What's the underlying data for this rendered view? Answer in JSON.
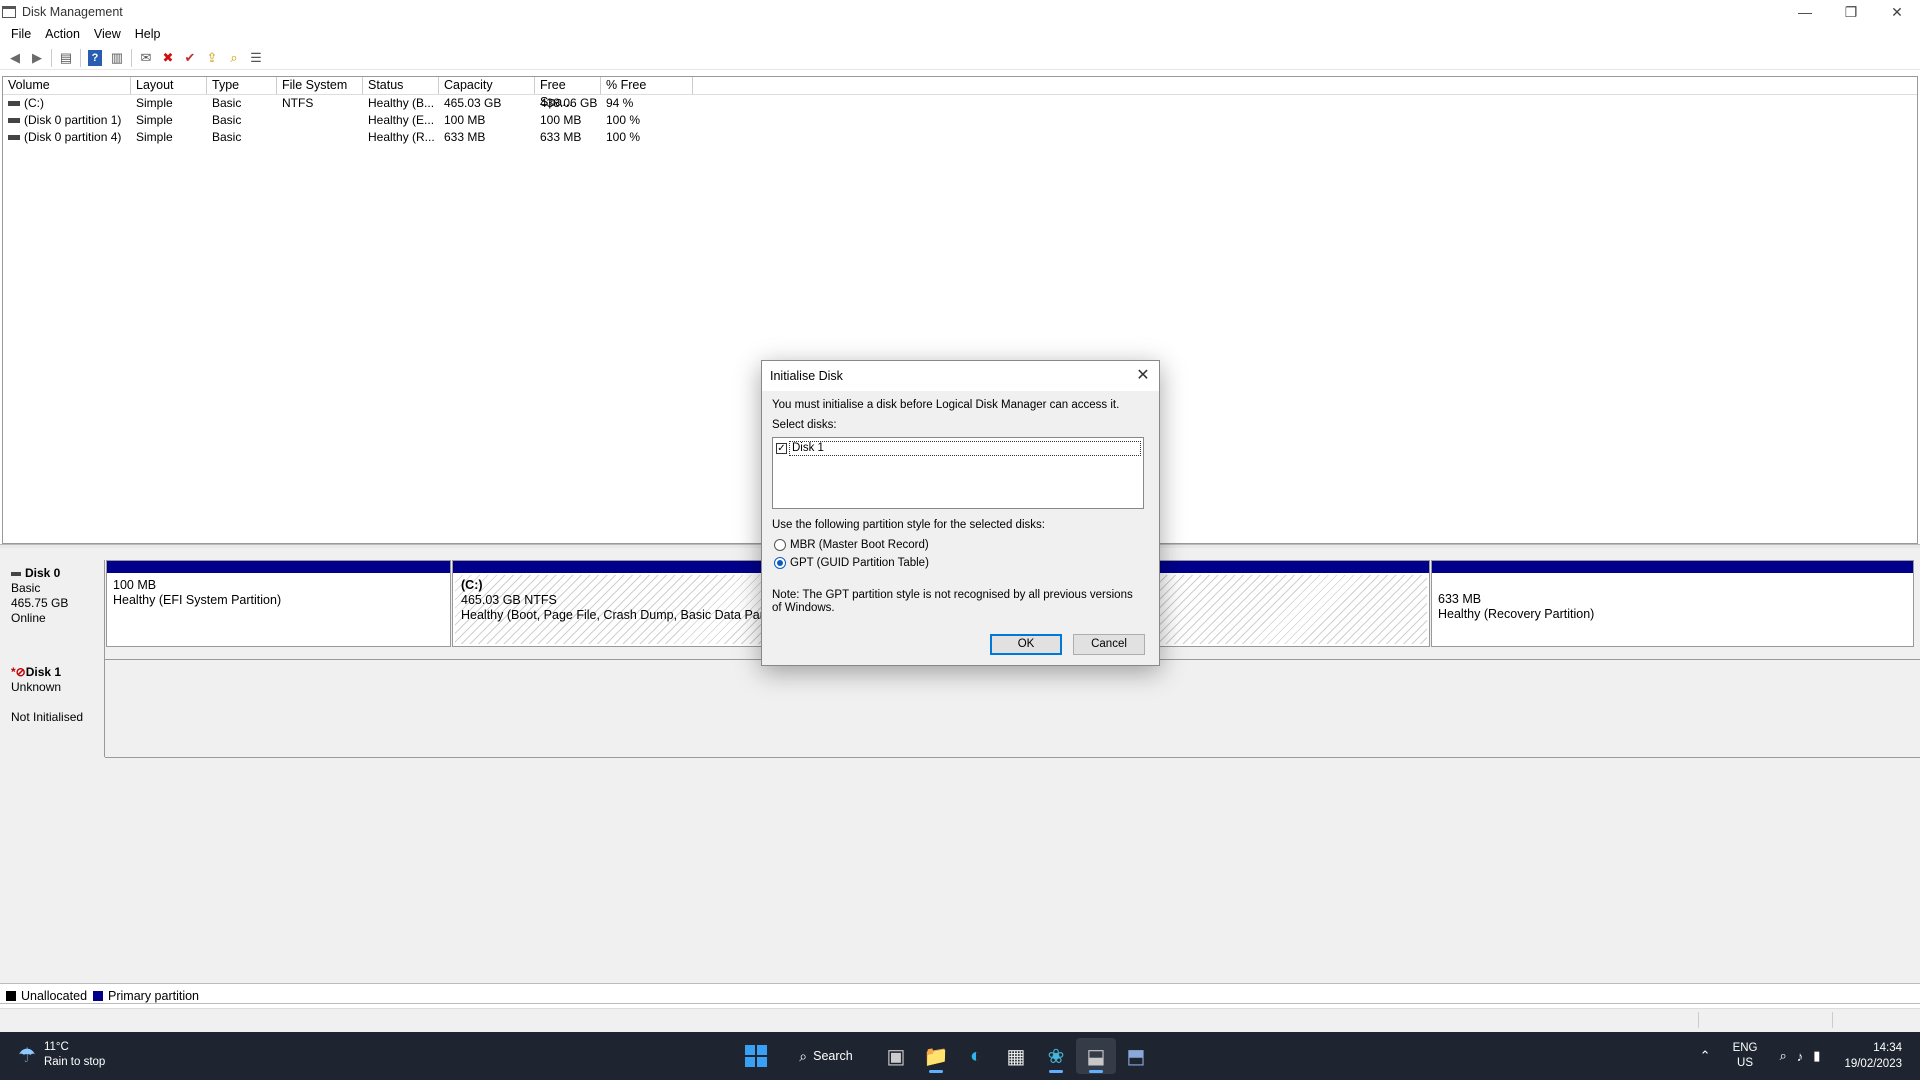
{
  "window": {
    "title": "Disk Management",
    "minimize_icon": "—",
    "restore_icon": "❐",
    "close_icon": "✕"
  },
  "menu": [
    "File",
    "Action",
    "View",
    "Help"
  ],
  "toolbar": {
    "back": "◀",
    "forward": "▶",
    "console": "▤",
    "help": "?",
    "console2": "▥",
    "connect": "✉",
    "delete": "✖",
    "properties": "✔",
    "explore": "⇪",
    "search": "⌕",
    "settings": "☰"
  },
  "volume_table": {
    "headers": [
      "Volume",
      "Layout",
      "Type",
      "File System",
      "Status",
      "Capacity",
      "Free Spa...",
      "% Free"
    ],
    "rows": [
      [
        "(C:)",
        "Simple",
        "Basic",
        "NTFS",
        "Healthy (B...",
        "465.03 GB",
        "438.06 GB",
        "94 %"
      ],
      [
        "(Disk 0 partition 1)",
        "Simple",
        "Basic",
        "",
        "Healthy (E...",
        "100 MB",
        "100 MB",
        "100 %"
      ],
      [
        "(Disk 0 partition 4)",
        "Simple",
        "Basic",
        "",
        "Healthy (R...",
        "633 MB",
        "633 MB",
        "100 %"
      ]
    ]
  },
  "disks": {
    "disk0": {
      "name": "Disk 0",
      "type": "Basic",
      "size": "465.75 GB",
      "status": "Online",
      "partitions": {
        "efi": {
          "size": "100 MB",
          "status": "Healthy (EFI System Partition)"
        },
        "c": {
          "label": "(C:)",
          "size": "465.03 GB NTFS",
          "status": "Healthy (Boot, Page File, Crash Dump, Basic Data Partition)"
        },
        "recovery": {
          "size": "633 MB",
          "status": "Healthy (Recovery Partition)"
        }
      }
    },
    "disk1": {
      "marker": "*⊘",
      "name": "Disk 1",
      "type": "Unknown",
      "status": "Not Initialised"
    }
  },
  "legend": {
    "unallocated": "Unallocated",
    "primary": "Primary partition",
    "colors": {
      "unallocated": "#000000",
      "primary": "#00008b"
    }
  },
  "dialog": {
    "title": "Initialise Disk",
    "intro": "You must initialise a disk before Logical Disk Manager can access it.",
    "select_label": "Select disks:",
    "disk_item": "Disk 1",
    "disk_checked": "✓",
    "style_label": "Use the following partition style for the selected disks:",
    "mbr": "MBR (Master Boot Record)",
    "gpt": "GPT (GUID Partition Table)",
    "note": "Note: The GPT partition style is not recognised by all previous versions of Windows.",
    "ok": "OK",
    "cancel": "Cancel"
  },
  "taskbar": {
    "weather_temp": "11°C",
    "weather_desc": "Rain to stop",
    "weather_icon": "☂",
    "search_label": "Search",
    "search_icon": "⌕",
    "apps": {
      "task_view": "▣",
      "file_explorer": "📁",
      "edge": "◐",
      "store": "▦",
      "app5": "❀",
      "disk_mgmt": "⬓",
      "app7": "⬒"
    },
    "tray": {
      "chevron": "⌃",
      "lang1": "ENG",
      "lang2": "US",
      "wifi": "⌕",
      "volume": "♪",
      "battery": "▮",
      "time": "14:34",
      "date": "19/02/2023"
    }
  }
}
